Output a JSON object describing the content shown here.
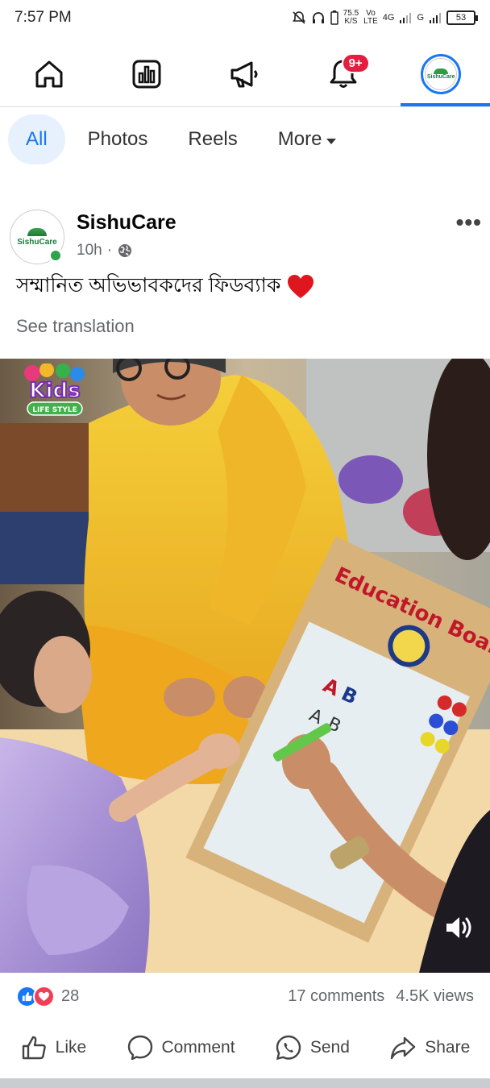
{
  "status_bar": {
    "time": "7:57 PM",
    "speed": "75.5",
    "speed_unit": "K/S",
    "volte": "Vo",
    "lte": "LTE",
    "net_4g": "4G",
    "net_g": "G",
    "battery": "53"
  },
  "top_nav": {
    "notification_badge": "9+",
    "profile_brand": "SishuCare"
  },
  "filter_tabs": [
    {
      "label": "All",
      "active": true
    },
    {
      "label": "Photos",
      "active": false
    },
    {
      "label": "Reels",
      "active": false
    },
    {
      "label": "More",
      "active": false
    }
  ],
  "post": {
    "page_name": "SishuCare",
    "time": "10h",
    "separator": "·",
    "text": "সম্মানিত অভিভাবকদের ফিডব্যাক",
    "see_translation": "See translation",
    "video_overlay": {
      "kids_logo_main": "Kids",
      "kids_logo_sub": "LIFE STYLE",
      "board_label": "Education Board"
    },
    "reaction_count": "28",
    "comments": "17 comments",
    "views": "4.5K views"
  },
  "actions": {
    "like": "Like",
    "comment": "Comment",
    "send": "Send",
    "share": "Share"
  },
  "colors": {
    "accent": "#1877f2",
    "badge": "#e41e3f",
    "love": "#f33e58",
    "online": "#31a24c"
  }
}
